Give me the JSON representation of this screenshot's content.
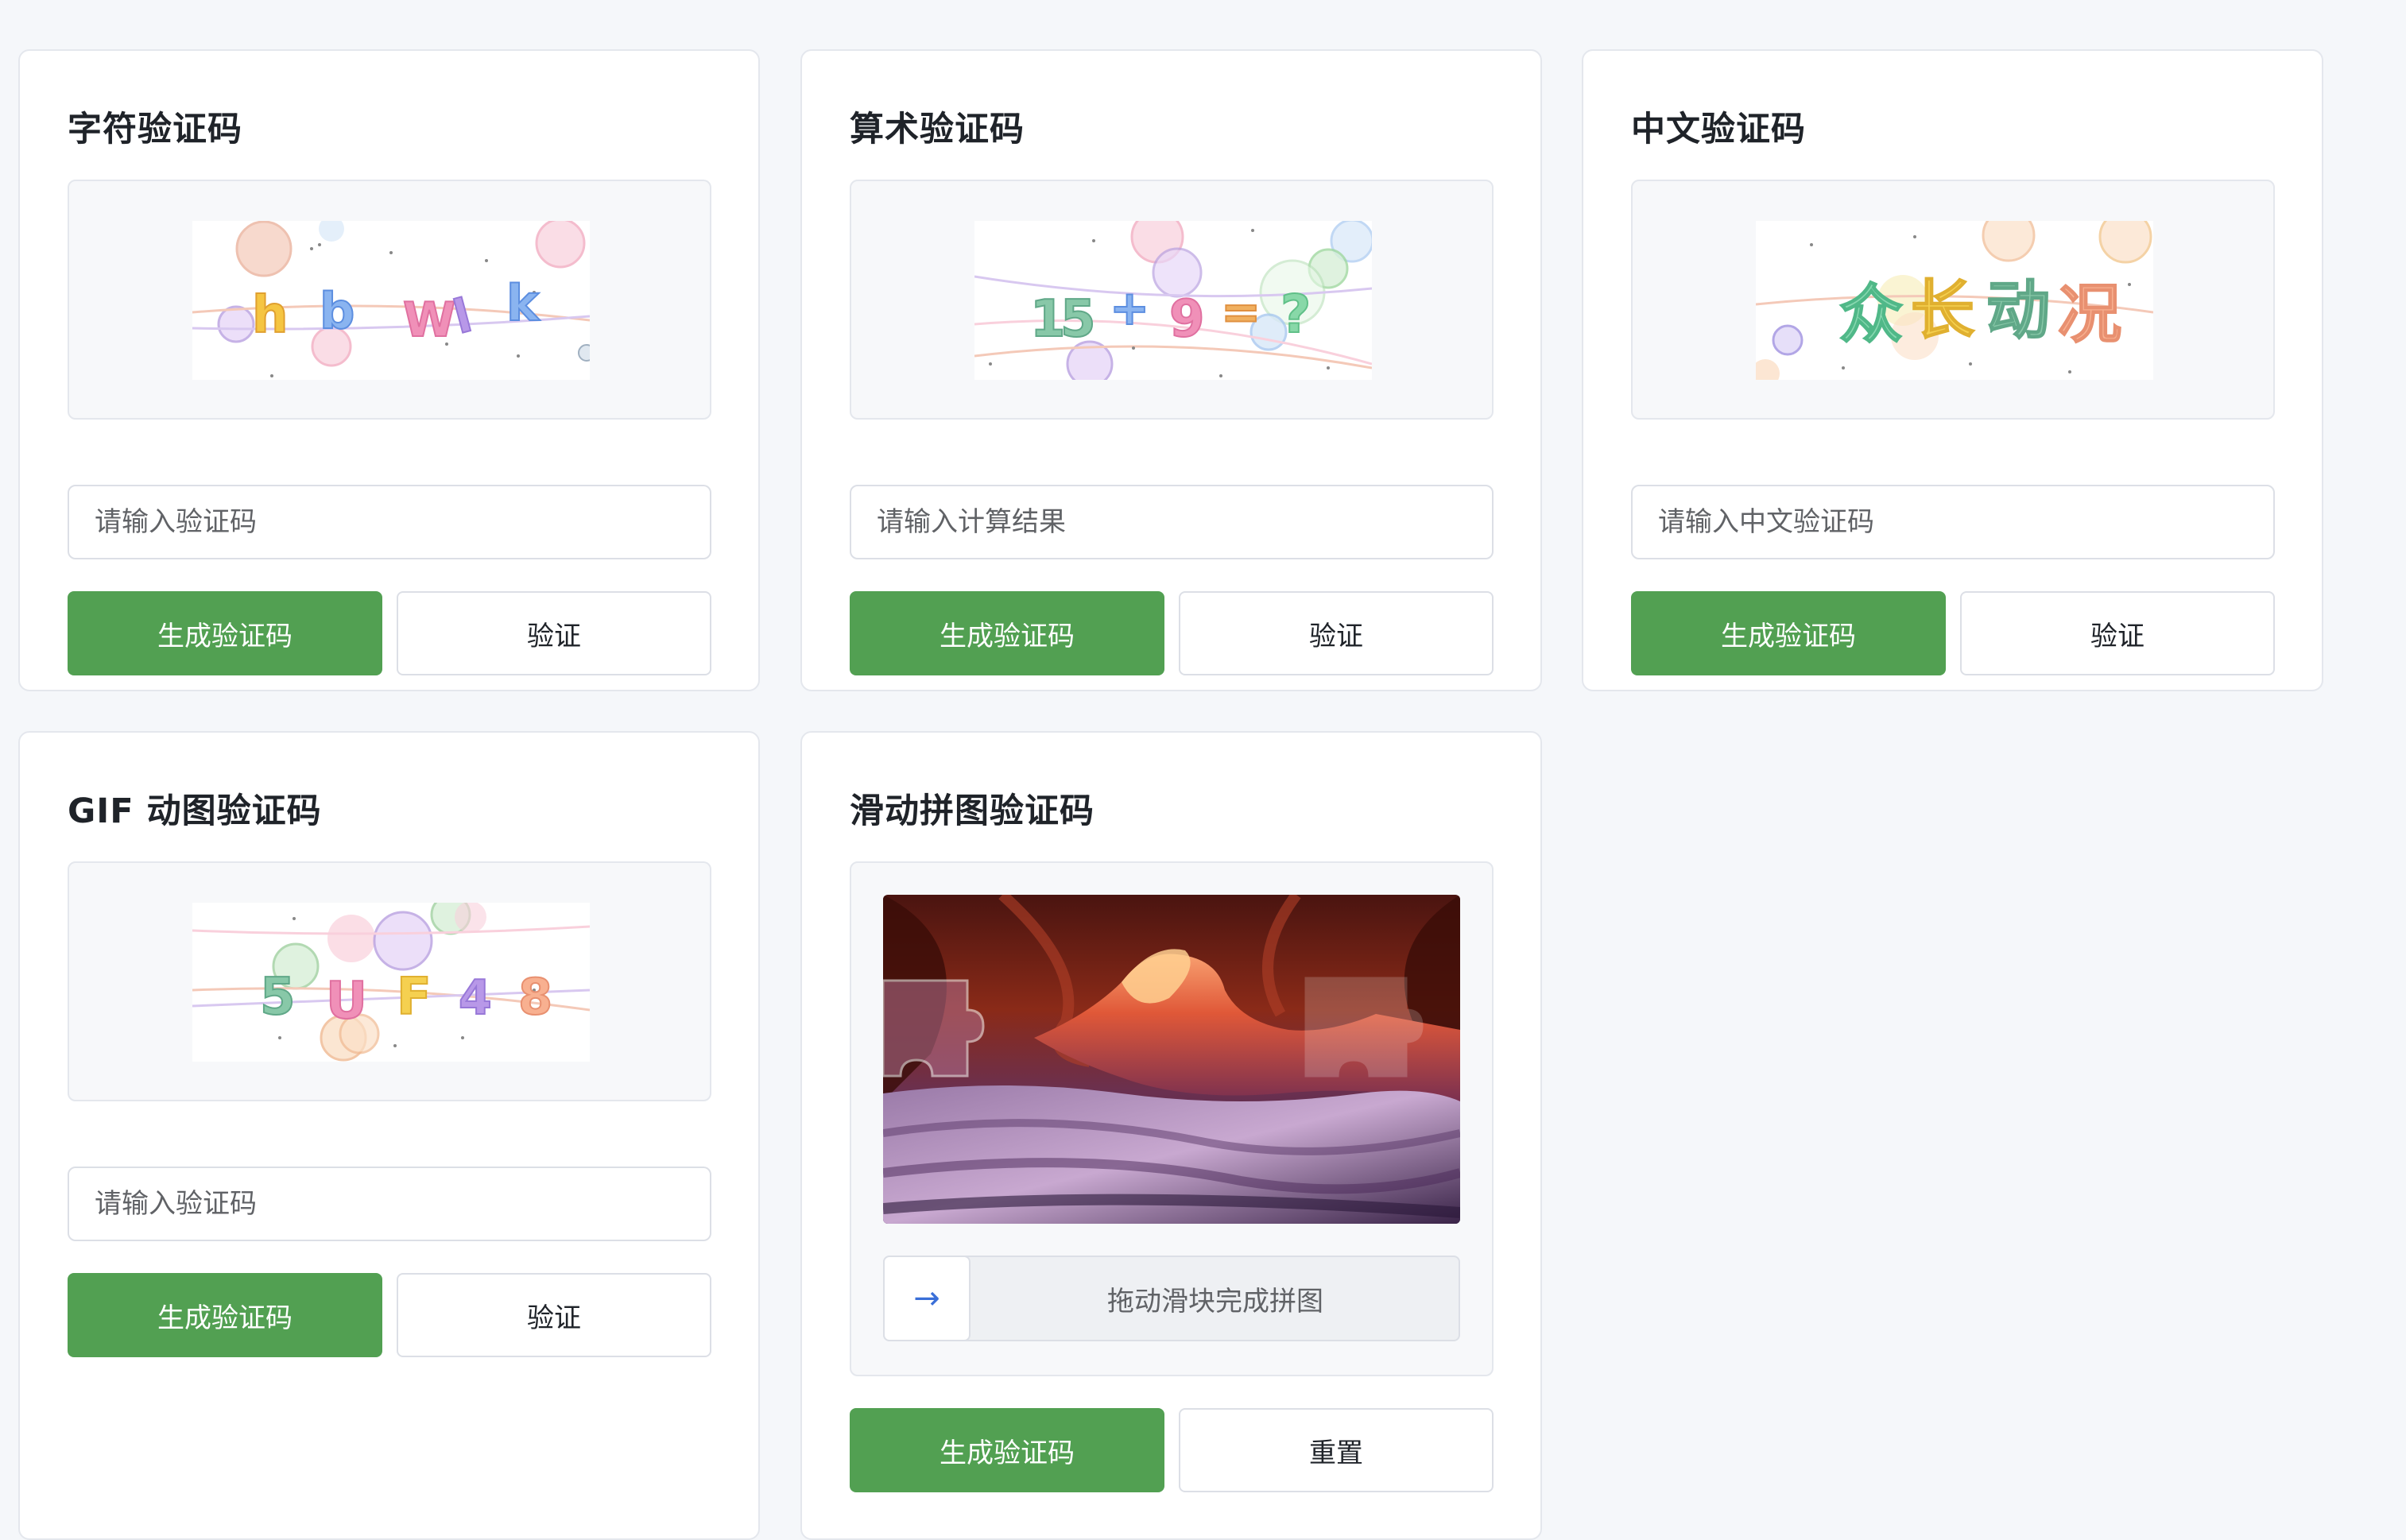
{
  "cards": [
    {
      "title": "字符验证码",
      "captcha_text": [
        "h",
        "b",
        "W",
        "l",
        "k"
      ],
      "placeholder": "请输入验证码",
      "generate_label": "生成验证码",
      "verify_label": "验证"
    },
    {
      "title": "算术验证码",
      "captcha_text": [
        "1",
        "5",
        "+",
        "9",
        "=",
        "?"
      ],
      "placeholder": "请输入计算结果",
      "generate_label": "生成验证码",
      "verify_label": "验证"
    },
    {
      "title": "中文验证码",
      "captcha_text": [
        "众",
        "长",
        "动",
        "况"
      ],
      "placeholder": "请输入中文验证码",
      "generate_label": "生成验证码",
      "verify_label": "验证"
    },
    {
      "title": "GIF 动图验证码",
      "captcha_text": [
        "5",
        "U",
        "F",
        "4",
        "8"
      ],
      "placeholder": "请输入验证码",
      "generate_label": "生成验证码",
      "verify_label": "验证"
    },
    {
      "title": "滑动拼图验证码",
      "slider_hint": "拖动滑块完成拼图",
      "slider_icon": "arrow-right-icon",
      "generate_label": "生成验证码",
      "reset_label": "重置"
    }
  ],
  "colors": {
    "primary": "#52a052",
    "page_bg": "#f5f7fa",
    "card_border": "#e4e7ed",
    "slider_arrow": "#3a6fd8"
  }
}
